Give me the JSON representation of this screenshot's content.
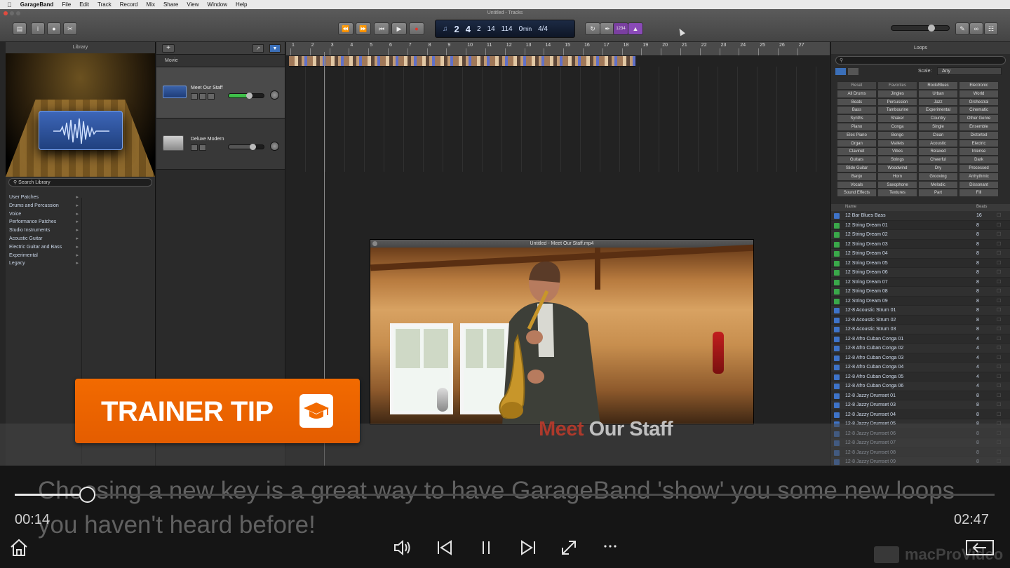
{
  "menubar": {
    "app": "GarageBand",
    "items": [
      "File",
      "Edit",
      "Track",
      "Record",
      "Mix",
      "Share",
      "View",
      "Window",
      "Help"
    ]
  },
  "window": {
    "title": "Untitled - Tracks"
  },
  "lcd": {
    "bar": "2",
    "beat": "4",
    "div": "2",
    "tick": "14",
    "tempo": "114",
    "key": "0",
    "key_unit": "min",
    "sig_top": "4",
    "sig_bottom": "4"
  },
  "cycle_count": "1234",
  "library": {
    "title": "Library",
    "search_placeholder": "Search Library",
    "items": [
      "User Patches",
      "Drums and Percussion",
      "Voice",
      "Performance Patches",
      "Studio Instruments",
      "Acoustic Guitar",
      "Electric Guitar and Bass",
      "Experimental",
      "Legacy"
    ]
  },
  "tracks": {
    "movie_label": "Movie",
    "items": [
      {
        "name": "Meet Our Staff",
        "volume": 0.55
      },
      {
        "name": "Deluxe Modern",
        "volume": 0.65
      }
    ]
  },
  "ruler": {
    "numbers": [
      "1",
      "2",
      "3",
      "4",
      "5",
      "6",
      "7",
      "8",
      "9",
      "10",
      "11",
      "12",
      "13",
      "14",
      "15",
      "16",
      "17",
      "18",
      "19",
      "20",
      "21",
      "22",
      "23",
      "24",
      "25",
      "26",
      "27"
    ]
  },
  "video": {
    "title": "Untitled - Meet Our Staff.mp4",
    "caption_red": "Meet ",
    "caption_white": "Our Staff"
  },
  "loops": {
    "title": "Loops",
    "scale_label": "Scale:",
    "scale_value": "Any",
    "keywords": [
      [
        "Reset",
        "Favorites",
        "Rock/Blues",
        "Electronic"
      ],
      [
        "All Drums",
        "Jingles",
        "Urban",
        "World"
      ],
      [
        "Beats",
        "Percussion",
        "Jazz",
        "Orchestral"
      ],
      [
        "Bass",
        "Tambourine",
        "Experimental",
        "Cinematic"
      ],
      [
        "Synths",
        "Shaker",
        "Country",
        "Other Genre"
      ],
      [
        "Piano",
        "Conga",
        "Single",
        "Ensemble"
      ],
      [
        "Elec Piano",
        "Bongo",
        "Clean",
        "Distorted"
      ],
      [
        "Organ",
        "Mallets",
        "Acoustic",
        "Electric"
      ],
      [
        "Clavinet",
        "Vibes",
        "Relaxed",
        "Intense"
      ],
      [
        "Guitars",
        "Strings",
        "Cheerful",
        "Dark"
      ],
      [
        "Slide Guitar",
        "Woodwind",
        "Dry",
        "Processed"
      ],
      [
        "Banjo",
        "Horn",
        "Grooving",
        "Arrhythmic"
      ],
      [
        "Vocals",
        "Saxophone",
        "Melodic",
        "Dissonant"
      ],
      [
        "Sound Effects",
        "Textures",
        "Part",
        "Fill"
      ]
    ],
    "col_name": "Name",
    "col_beats": "Beats",
    "rows": [
      {
        "name": "12 Bar Blues Bass",
        "beats": "16",
        "kind": "blue"
      },
      {
        "name": "12 String Dream 01",
        "beats": "8",
        "kind": "green"
      },
      {
        "name": "12 String Dream 02",
        "beats": "8",
        "kind": "green"
      },
      {
        "name": "12 String Dream 03",
        "beats": "8",
        "kind": "green"
      },
      {
        "name": "12 String Dream 04",
        "beats": "8",
        "kind": "green"
      },
      {
        "name": "12 String Dream 05",
        "beats": "8",
        "kind": "green"
      },
      {
        "name": "12 String Dream 06",
        "beats": "8",
        "kind": "green"
      },
      {
        "name": "12 String Dream 07",
        "beats": "8",
        "kind": "green"
      },
      {
        "name": "12 String Dream 08",
        "beats": "8",
        "kind": "green"
      },
      {
        "name": "12 String Dream 09",
        "beats": "8",
        "kind": "green"
      },
      {
        "name": "12-8 Acoustic Strum 01",
        "beats": "8",
        "kind": "blue"
      },
      {
        "name": "12-8 Acoustic Strum 02",
        "beats": "8",
        "kind": "blue"
      },
      {
        "name": "12-8 Acoustic Strum 03",
        "beats": "8",
        "kind": "blue"
      },
      {
        "name": "12-8 Afro Cuban Conga 01",
        "beats": "4",
        "kind": "blue"
      },
      {
        "name": "12-8 Afro Cuban Conga 02",
        "beats": "4",
        "kind": "blue"
      },
      {
        "name": "12-8 Afro Cuban Conga 03",
        "beats": "4",
        "kind": "blue"
      },
      {
        "name": "12-8 Afro Cuban Conga 04",
        "beats": "4",
        "kind": "blue"
      },
      {
        "name": "12-8 Afro Cuban Conga 05",
        "beats": "4",
        "kind": "blue"
      },
      {
        "name": "12-8 Afro Cuban Conga 06",
        "beats": "4",
        "kind": "blue"
      },
      {
        "name": "12-8 Jazzy Drumset 01",
        "beats": "8",
        "kind": "blue"
      },
      {
        "name": "12-8 Jazzy Drumset 03",
        "beats": "8",
        "kind": "blue"
      },
      {
        "name": "12-8 Jazzy Drumset 04",
        "beats": "8",
        "kind": "blue"
      },
      {
        "name": "12-8 Jazzy Drumset 05",
        "beats": "8",
        "kind": "blue"
      },
      {
        "name": "12-8 Jazzy Drumset 06",
        "beats": "8",
        "kind": "blue"
      },
      {
        "name": "12-8 Jazzy Drumset 07",
        "beats": "8",
        "kind": "blue"
      },
      {
        "name": "12-8 Jazzy Drumset 08",
        "beats": "8",
        "kind": "blue"
      },
      {
        "name": "12-8 Jazzy Drumset 09",
        "beats": "8",
        "kind": "blue"
      }
    ]
  },
  "overlay": {
    "tip_label": "TRAINER TIP",
    "subtitle": "Choosing a new key is a great way to have GarageBand 'show' you some new loops you haven't heard before!"
  },
  "player": {
    "current_time": "00:14",
    "total_time": "02:47",
    "progress": 0.074,
    "watermark": "macProVideo"
  },
  "colors": {
    "tip_orange": "#f26a00",
    "loop_green": "#3aa84a",
    "loop_blue": "#3e73c8",
    "lcd_bg": "#1c2a44"
  }
}
